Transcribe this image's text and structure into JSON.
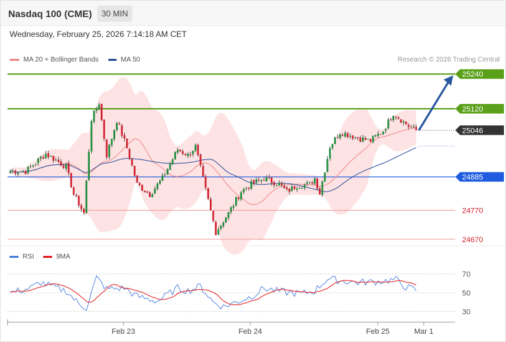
{
  "header": {
    "instrument": "Nasdaq 100 (CME)",
    "timeframe": "30 MIN",
    "datetime": "Wednesday, February 25, 2026 7:14:18 AM CET"
  },
  "legend": {
    "bollinger_label": "MA 20 + Bollinger Bands",
    "ma50_label": "MA 50",
    "rsi_label": "RSI",
    "rsi_ma_label": "9MA",
    "credit": "Research © 2026 Trading Central"
  },
  "colors": {
    "bull": "#1e8c3c",
    "bear": "#d0202e",
    "band_fill": "#fde0e0",
    "ma20": "#e88",
    "ma50": "#2a4f9c",
    "resistance": "#5aa019",
    "pivot": "#1f5ce0",
    "support": "#f09a9a",
    "current": "#333333",
    "arrow": "#2a58a0",
    "rsi": "#4a7fe0",
    "rsi_ma": "#e41f1f"
  },
  "chart_data": [
    {
      "type": "candlestick",
      "title": "Nasdaq 100 (CME) 30 MIN",
      "x_labels": [
        "Feb 23",
        "Feb 24",
        "Feb 25",
        "Mar 1"
      ],
      "ylim": [
        24620,
        25290
      ],
      "levels": [
        {
          "name": "resistance",
          "value": 25240,
          "label": "25240"
        },
        {
          "name": "resistance",
          "value": 25120,
          "label": "25120"
        },
        {
          "name": "current",
          "value": 25046,
          "label": "25046"
        },
        {
          "name": "pivot",
          "value": 24885,
          "label": "24885"
        },
        {
          "name": "support",
          "value": 24770,
          "label": "24770"
        },
        {
          "name": "support",
          "value": 24670,
          "label": "24670"
        }
      ],
      "target_arrow": {
        "from_value": 25046,
        "to_value": 25240
      },
      "pivots": [
        {
          "i": 0,
          "v": 24905
        },
        {
          "i": 6,
          "v": 24905
        },
        {
          "i": 14,
          "v": 24965
        },
        {
          "i": 22,
          "v": 24920
        },
        {
          "i": 25,
          "v": 24825
        },
        {
          "i": 29,
          "v": 24760
        },
        {
          "i": 32,
          "v": 25085
        },
        {
          "i": 35,
          "v": 25140
        },
        {
          "i": 38,
          "v": 24960
        },
        {
          "i": 42,
          "v": 25080
        },
        {
          "i": 46,
          "v": 24985
        },
        {
          "i": 50,
          "v": 24860
        },
        {
          "i": 55,
          "v": 24825
        },
        {
          "i": 60,
          "v": 24880
        },
        {
          "i": 66,
          "v": 24980
        },
        {
          "i": 70,
          "v": 24960
        },
        {
          "i": 73,
          "v": 24990
        },
        {
          "i": 77,
          "v": 24840
        },
        {
          "i": 81,
          "v": 24695
        },
        {
          "i": 86,
          "v": 24760
        },
        {
          "i": 91,
          "v": 24835
        },
        {
          "i": 95,
          "v": 24860
        },
        {
          "i": 100,
          "v": 24880
        },
        {
          "i": 106,
          "v": 24860
        },
        {
          "i": 109,
          "v": 24835
        },
        {
          "i": 113,
          "v": 24855
        },
        {
          "i": 118,
          "v": 24860
        },
        {
          "i": 120,
          "v": 24880
        },
        {
          "i": 122,
          "v": 24830
        },
        {
          "i": 126,
          "v": 24990
        },
        {
          "i": 130,
          "v": 25040
        },
        {
          "i": 137,
          "v": 25020
        },
        {
          "i": 142,
          "v": 25010
        },
        {
          "i": 147,
          "v": 25045
        },
        {
          "i": 151,
          "v": 25105
        },
        {
          "i": 157,
          "v": 25060
        },
        {
          "i": 160,
          "v": 25046
        }
      ],
      "rsi": {
        "ylim": [
          20,
          80
        ],
        "levels": [
          70,
          50,
          30
        ],
        "rsi_pivots": [
          {
            "i": 0,
            "v": 50
          },
          {
            "i": 8,
            "v": 55
          },
          {
            "i": 12,
            "v": 61
          },
          {
            "i": 17,
            "v": 56
          },
          {
            "i": 22,
            "v": 52
          },
          {
            "i": 27,
            "v": 38
          },
          {
            "i": 30,
            "v": 34
          },
          {
            "i": 34,
            "v": 66
          },
          {
            "i": 38,
            "v": 54
          },
          {
            "i": 45,
            "v": 55
          },
          {
            "i": 50,
            "v": 46
          },
          {
            "i": 58,
            "v": 41
          },
          {
            "i": 66,
            "v": 55
          },
          {
            "i": 70,
            "v": 52
          },
          {
            "i": 75,
            "v": 57
          },
          {
            "i": 80,
            "v": 40
          },
          {
            "i": 84,
            "v": 35
          },
          {
            "i": 90,
            "v": 41
          },
          {
            "i": 95,
            "v": 46
          },
          {
            "i": 100,
            "v": 55
          },
          {
            "i": 105,
            "v": 52
          },
          {
            "i": 110,
            "v": 50
          },
          {
            "i": 115,
            "v": 49
          },
          {
            "i": 120,
            "v": 52
          },
          {
            "i": 125,
            "v": 65
          },
          {
            "i": 130,
            "v": 63
          },
          {
            "i": 137,
            "v": 61
          },
          {
            "i": 145,
            "v": 62
          },
          {
            "i": 152,
            "v": 64
          },
          {
            "i": 156,
            "v": 56
          },
          {
            "i": 160,
            "v": 53
          }
        ]
      }
    }
  ],
  "rsi_tick_labels": [
    "70",
    "50",
    "30"
  ]
}
